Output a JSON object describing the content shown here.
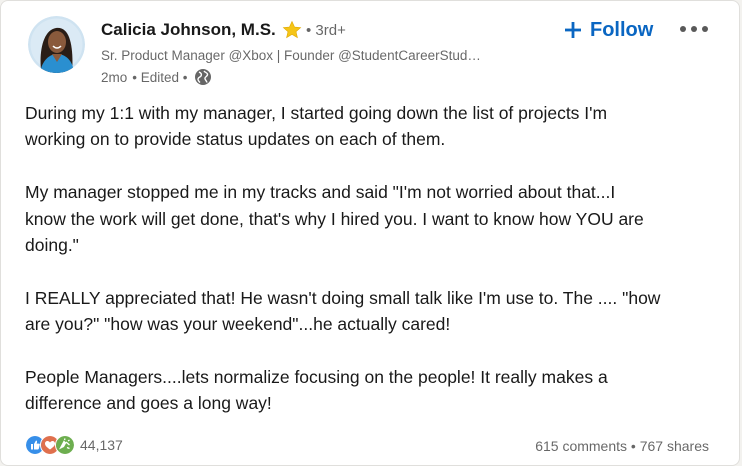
{
  "post": {
    "author": {
      "name": "Calicia Johnson, M.S.",
      "degree": "• 3rd+",
      "headline": "Sr. Product Manager @Xbox | Founder @StudentCareerStud…",
      "time": "2mo",
      "edited": "• Edited •",
      "star_icon": "gold-star-icon",
      "visibility_icon": "globe-icon"
    },
    "follow_label": "Follow",
    "more_icon": "ellipsis-icon",
    "paragraphs": [
      "During my 1:1 with my manager, I started going down the list of projects I'm\nworking on to provide status updates on each of them.",
      "My manager stopped me in my tracks and said \"I'm not worried about that...I\nknow the work will get done, that's why I hired you. I want to know how YOU are\ndoing.\"",
      "I REALLY appreciated that! He wasn't doing small talk like I'm use to. The .... \"how\nare you?\" \"how was your weekend\"...he actually cared!",
      "People Managers....lets normalize focusing on the people! It really makes a\ndifference and goes a long way!"
    ],
    "reactions": {
      "icons": [
        "like-icon",
        "love-icon",
        "celebrate-icon"
      ],
      "count": "44,137"
    },
    "comments": "615 comments",
    "separator": "•",
    "shares": "767 shares"
  },
  "colors": {
    "accent": "#0a66c2",
    "like": "#378fe9",
    "love": "#df704d",
    "celebrate": "#6dae4f",
    "star": "#f5c518"
  }
}
